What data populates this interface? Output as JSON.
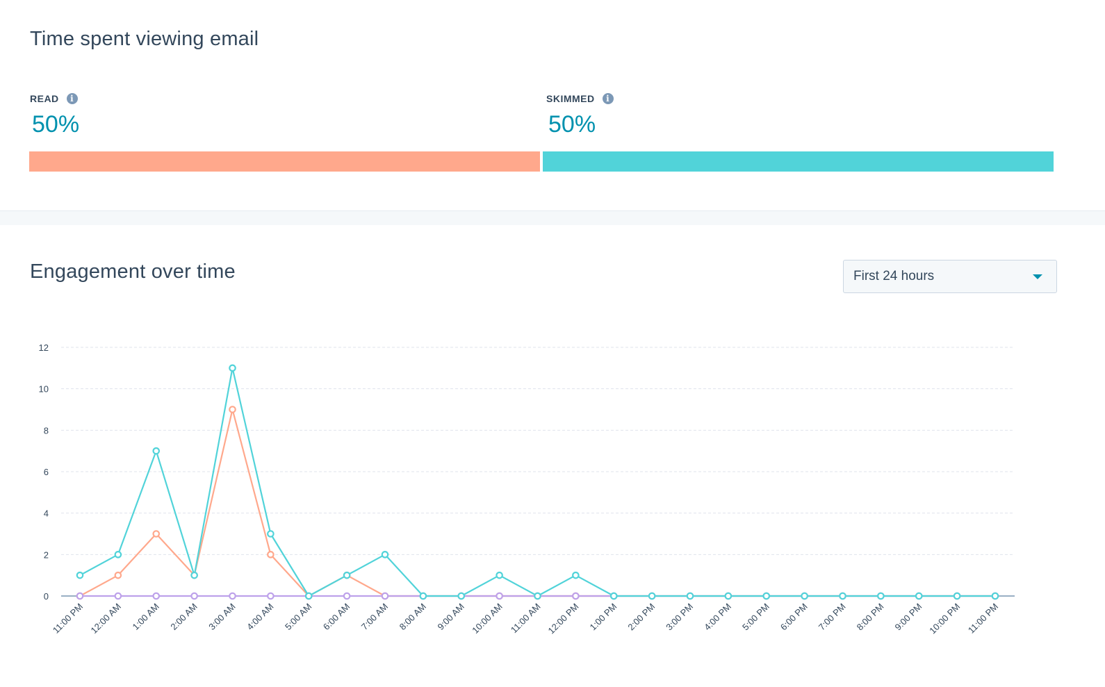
{
  "time_spent": {
    "title": "Time spent viewing email",
    "read": {
      "label": "READ",
      "value": "50%",
      "fraction": 0.5,
      "color": "#ffa88c",
      "info_icon": "info-icon"
    },
    "skimmed": {
      "label": "SKIMMED",
      "value": "50%",
      "fraction": 0.5,
      "color": "#51d3d9",
      "info_icon": "info-icon"
    }
  },
  "engagement": {
    "title": "Engagement over time",
    "range_select": {
      "selected": "First 24 hours",
      "icon": "caret-down-icon"
    }
  },
  "chart_data": {
    "type": "line",
    "title": "Engagement over time",
    "xlabel": "",
    "ylabel": "",
    "ylim": [
      0,
      12
    ],
    "yticks": [
      0,
      2,
      4,
      6,
      8,
      10,
      12
    ],
    "grid": true,
    "x": [
      "11:00 PM",
      "12:00 AM",
      "1:00 AM",
      "2:00 AM",
      "3:00 AM",
      "4:00 AM",
      "5:00 AM",
      "6:00 AM",
      "7:00 AM",
      "8:00 AM",
      "9:00 AM",
      "10:00 AM",
      "11:00 AM",
      "12:00 PM",
      "1:00 PM",
      "2:00 PM",
      "3:00 PM",
      "4:00 PM",
      "5:00 PM",
      "6:00 PM",
      "7:00 PM",
      "8:00 PM",
      "9:00 PM",
      "10:00 PM",
      "11:00 PM"
    ],
    "series": [
      {
        "name": "purple-series",
        "color": "#bda1ea",
        "values": [
          0,
          0,
          0,
          0,
          0,
          0,
          0,
          0,
          0,
          0,
          0,
          0,
          0,
          0,
          0,
          0,
          0,
          0,
          0,
          0,
          0,
          0,
          0,
          0,
          0
        ]
      },
      {
        "name": "orange-series",
        "color": "#ffa88c",
        "values": [
          0,
          1,
          3,
          1,
          9,
          2,
          0,
          1,
          0,
          0,
          0,
          0,
          0,
          0,
          0,
          0,
          0,
          0,
          0,
          0,
          0,
          0,
          0,
          0,
          0
        ]
      },
      {
        "name": "teal-series",
        "color": "#51d3d9",
        "values": [
          1,
          2,
          7,
          1,
          11,
          3,
          0,
          1,
          2,
          0,
          0,
          1,
          0,
          1,
          0,
          0,
          0,
          0,
          0,
          0,
          0,
          0,
          0,
          0,
          0
        ]
      }
    ]
  }
}
